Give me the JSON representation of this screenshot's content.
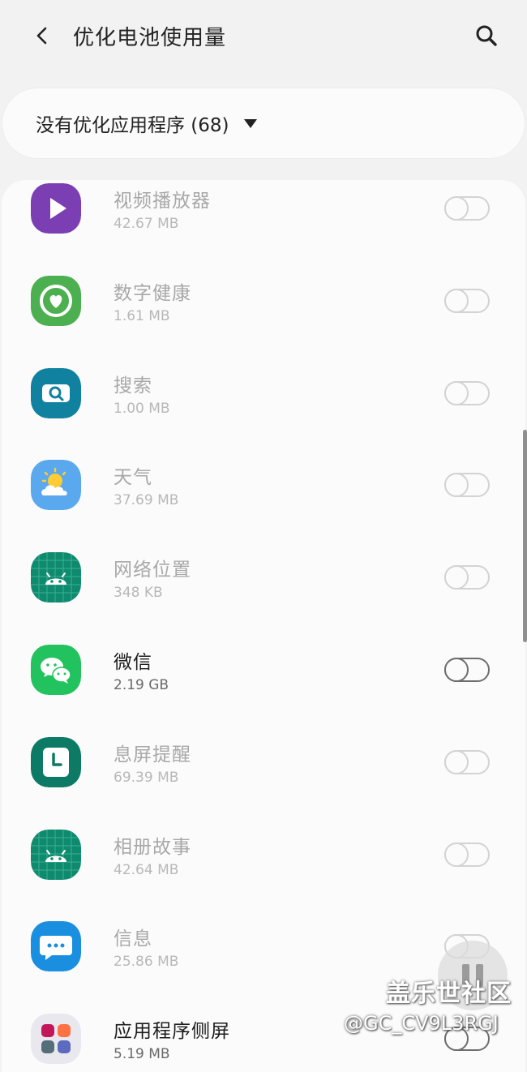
{
  "header": {
    "title": "优化电池使用量",
    "back_icon": "back-arrow-icon",
    "search_icon": "search-icon"
  },
  "filter": {
    "label": "没有优化应用程序 (68)",
    "dropdown_icon": "dropdown-triangle-icon"
  },
  "apps": [
    {
      "name": "视频播放器",
      "size": "42.67 MB",
      "icon": "video-player-icon",
      "active": false
    },
    {
      "name": "数字健康",
      "size": "1.61 MB",
      "icon": "digital-wellbeing-icon",
      "active": false
    },
    {
      "name": "搜索",
      "size": "1.00 MB",
      "icon": "search-app-icon",
      "active": false
    },
    {
      "name": "天气",
      "size": "37.69 MB",
      "icon": "weather-icon",
      "active": false
    },
    {
      "name": "网络位置",
      "size": "348 KB",
      "icon": "android-icon",
      "active": false
    },
    {
      "name": "微信",
      "size": "2.19 GB",
      "icon": "wechat-icon",
      "active": true
    },
    {
      "name": "息屏提醒",
      "size": "69.39 MB",
      "icon": "clock-icon",
      "active": false
    },
    {
      "name": "相册故事",
      "size": "42.64 MB",
      "icon": "android-icon",
      "active": false
    },
    {
      "name": "信息",
      "size": "25.86 MB",
      "icon": "messages-icon",
      "active": false
    },
    {
      "name": "应用程序侧屏",
      "size": "5.19 MB",
      "icon": "apps-edge-icon",
      "active": true
    }
  ],
  "watermark": {
    "title": "盖乐世社区",
    "id": "@GC_CV9L3RGJ"
  },
  "colors": {
    "background": "#f2f2f2",
    "card": "#fbfbfb",
    "text_primary": "#1c1c1c",
    "text_disabled": "#a8a8a8"
  }
}
